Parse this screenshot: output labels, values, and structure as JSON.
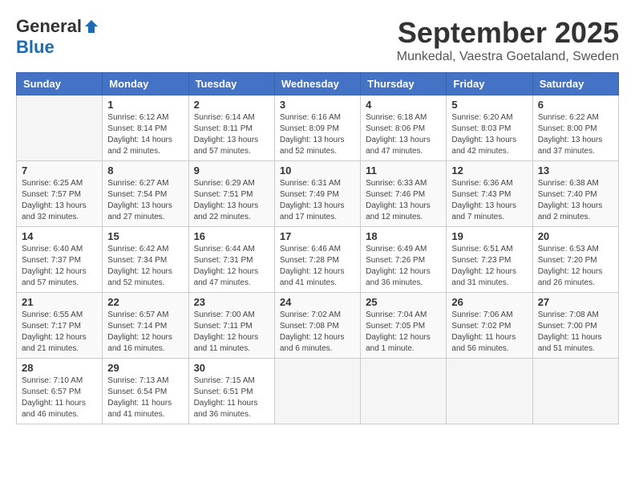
{
  "header": {
    "logo_general": "General",
    "logo_blue": "Blue",
    "month_title": "September 2025",
    "location": "Munkedal, Vaestra Goetaland, Sweden"
  },
  "weekdays": [
    "Sunday",
    "Monday",
    "Tuesday",
    "Wednesday",
    "Thursday",
    "Friday",
    "Saturday"
  ],
  "weeks": [
    [
      {
        "day": "",
        "sunrise": "",
        "sunset": "",
        "daylight": ""
      },
      {
        "day": "1",
        "sunrise": "Sunrise: 6:12 AM",
        "sunset": "Sunset: 8:14 PM",
        "daylight": "Daylight: 14 hours and 2 minutes."
      },
      {
        "day": "2",
        "sunrise": "Sunrise: 6:14 AM",
        "sunset": "Sunset: 8:11 PM",
        "daylight": "Daylight: 13 hours and 57 minutes."
      },
      {
        "day": "3",
        "sunrise": "Sunrise: 6:16 AM",
        "sunset": "Sunset: 8:09 PM",
        "daylight": "Daylight: 13 hours and 52 minutes."
      },
      {
        "day": "4",
        "sunrise": "Sunrise: 6:18 AM",
        "sunset": "Sunset: 8:06 PM",
        "daylight": "Daylight: 13 hours and 47 minutes."
      },
      {
        "day": "5",
        "sunrise": "Sunrise: 6:20 AM",
        "sunset": "Sunset: 8:03 PM",
        "daylight": "Daylight: 13 hours and 42 minutes."
      },
      {
        "day": "6",
        "sunrise": "Sunrise: 6:22 AM",
        "sunset": "Sunset: 8:00 PM",
        "daylight": "Daylight: 13 hours and 37 minutes."
      }
    ],
    [
      {
        "day": "7",
        "sunrise": "Sunrise: 6:25 AM",
        "sunset": "Sunset: 7:57 PM",
        "daylight": "Daylight: 13 hours and 32 minutes."
      },
      {
        "day": "8",
        "sunrise": "Sunrise: 6:27 AM",
        "sunset": "Sunset: 7:54 PM",
        "daylight": "Daylight: 13 hours and 27 minutes."
      },
      {
        "day": "9",
        "sunrise": "Sunrise: 6:29 AM",
        "sunset": "Sunset: 7:51 PM",
        "daylight": "Daylight: 13 hours and 22 minutes."
      },
      {
        "day": "10",
        "sunrise": "Sunrise: 6:31 AM",
        "sunset": "Sunset: 7:49 PM",
        "daylight": "Daylight: 13 hours and 17 minutes."
      },
      {
        "day": "11",
        "sunrise": "Sunrise: 6:33 AM",
        "sunset": "Sunset: 7:46 PM",
        "daylight": "Daylight: 13 hours and 12 minutes."
      },
      {
        "day": "12",
        "sunrise": "Sunrise: 6:36 AM",
        "sunset": "Sunset: 7:43 PM",
        "daylight": "Daylight: 13 hours and 7 minutes."
      },
      {
        "day": "13",
        "sunrise": "Sunrise: 6:38 AM",
        "sunset": "Sunset: 7:40 PM",
        "daylight": "Daylight: 13 hours and 2 minutes."
      }
    ],
    [
      {
        "day": "14",
        "sunrise": "Sunrise: 6:40 AM",
        "sunset": "Sunset: 7:37 PM",
        "daylight": "Daylight: 12 hours and 57 minutes."
      },
      {
        "day": "15",
        "sunrise": "Sunrise: 6:42 AM",
        "sunset": "Sunset: 7:34 PM",
        "daylight": "Daylight: 12 hours and 52 minutes."
      },
      {
        "day": "16",
        "sunrise": "Sunrise: 6:44 AM",
        "sunset": "Sunset: 7:31 PM",
        "daylight": "Daylight: 12 hours and 47 minutes."
      },
      {
        "day": "17",
        "sunrise": "Sunrise: 6:46 AM",
        "sunset": "Sunset: 7:28 PM",
        "daylight": "Daylight: 12 hours and 41 minutes."
      },
      {
        "day": "18",
        "sunrise": "Sunrise: 6:49 AM",
        "sunset": "Sunset: 7:26 PM",
        "daylight": "Daylight: 12 hours and 36 minutes."
      },
      {
        "day": "19",
        "sunrise": "Sunrise: 6:51 AM",
        "sunset": "Sunset: 7:23 PM",
        "daylight": "Daylight: 12 hours and 31 minutes."
      },
      {
        "day": "20",
        "sunrise": "Sunrise: 6:53 AM",
        "sunset": "Sunset: 7:20 PM",
        "daylight": "Daylight: 12 hours and 26 minutes."
      }
    ],
    [
      {
        "day": "21",
        "sunrise": "Sunrise: 6:55 AM",
        "sunset": "Sunset: 7:17 PM",
        "daylight": "Daylight: 12 hours and 21 minutes."
      },
      {
        "day": "22",
        "sunrise": "Sunrise: 6:57 AM",
        "sunset": "Sunset: 7:14 PM",
        "daylight": "Daylight: 12 hours and 16 minutes."
      },
      {
        "day": "23",
        "sunrise": "Sunrise: 7:00 AM",
        "sunset": "Sunset: 7:11 PM",
        "daylight": "Daylight: 12 hours and 11 minutes."
      },
      {
        "day": "24",
        "sunrise": "Sunrise: 7:02 AM",
        "sunset": "Sunset: 7:08 PM",
        "daylight": "Daylight: 12 hours and 6 minutes."
      },
      {
        "day": "25",
        "sunrise": "Sunrise: 7:04 AM",
        "sunset": "Sunset: 7:05 PM",
        "daylight": "Daylight: 12 hours and 1 minute."
      },
      {
        "day": "26",
        "sunrise": "Sunrise: 7:06 AM",
        "sunset": "Sunset: 7:02 PM",
        "daylight": "Daylight: 11 hours and 56 minutes."
      },
      {
        "day": "27",
        "sunrise": "Sunrise: 7:08 AM",
        "sunset": "Sunset: 7:00 PM",
        "daylight": "Daylight: 11 hours and 51 minutes."
      }
    ],
    [
      {
        "day": "28",
        "sunrise": "Sunrise: 7:10 AM",
        "sunset": "Sunset: 6:57 PM",
        "daylight": "Daylight: 11 hours and 46 minutes."
      },
      {
        "day": "29",
        "sunrise": "Sunrise: 7:13 AM",
        "sunset": "Sunset: 6:54 PM",
        "daylight": "Daylight: 11 hours and 41 minutes."
      },
      {
        "day": "30",
        "sunrise": "Sunrise: 7:15 AM",
        "sunset": "Sunset: 6:51 PM",
        "daylight": "Daylight: 11 hours and 36 minutes."
      },
      {
        "day": "",
        "sunrise": "",
        "sunset": "",
        "daylight": ""
      },
      {
        "day": "",
        "sunrise": "",
        "sunset": "",
        "daylight": ""
      },
      {
        "day": "",
        "sunrise": "",
        "sunset": "",
        "daylight": ""
      },
      {
        "day": "",
        "sunrise": "",
        "sunset": "",
        "daylight": ""
      }
    ]
  ]
}
